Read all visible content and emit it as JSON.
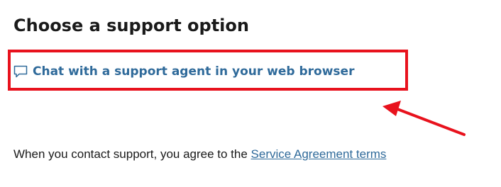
{
  "page": {
    "title": "Choose a support option"
  },
  "support_options": {
    "chat_link_label": "Chat with a support agent in your web browser",
    "chat_icon": "chat-bubble-icon"
  },
  "annotation": {
    "highlight_color": "#e8121d",
    "arrow_color": "#e8121d"
  },
  "agreement": {
    "text": "When you contact support, you agree to the ",
    "link_label": "Service Agreement terms"
  },
  "colors": {
    "link": "#2f6a9a",
    "text": "#1a1a1a"
  }
}
